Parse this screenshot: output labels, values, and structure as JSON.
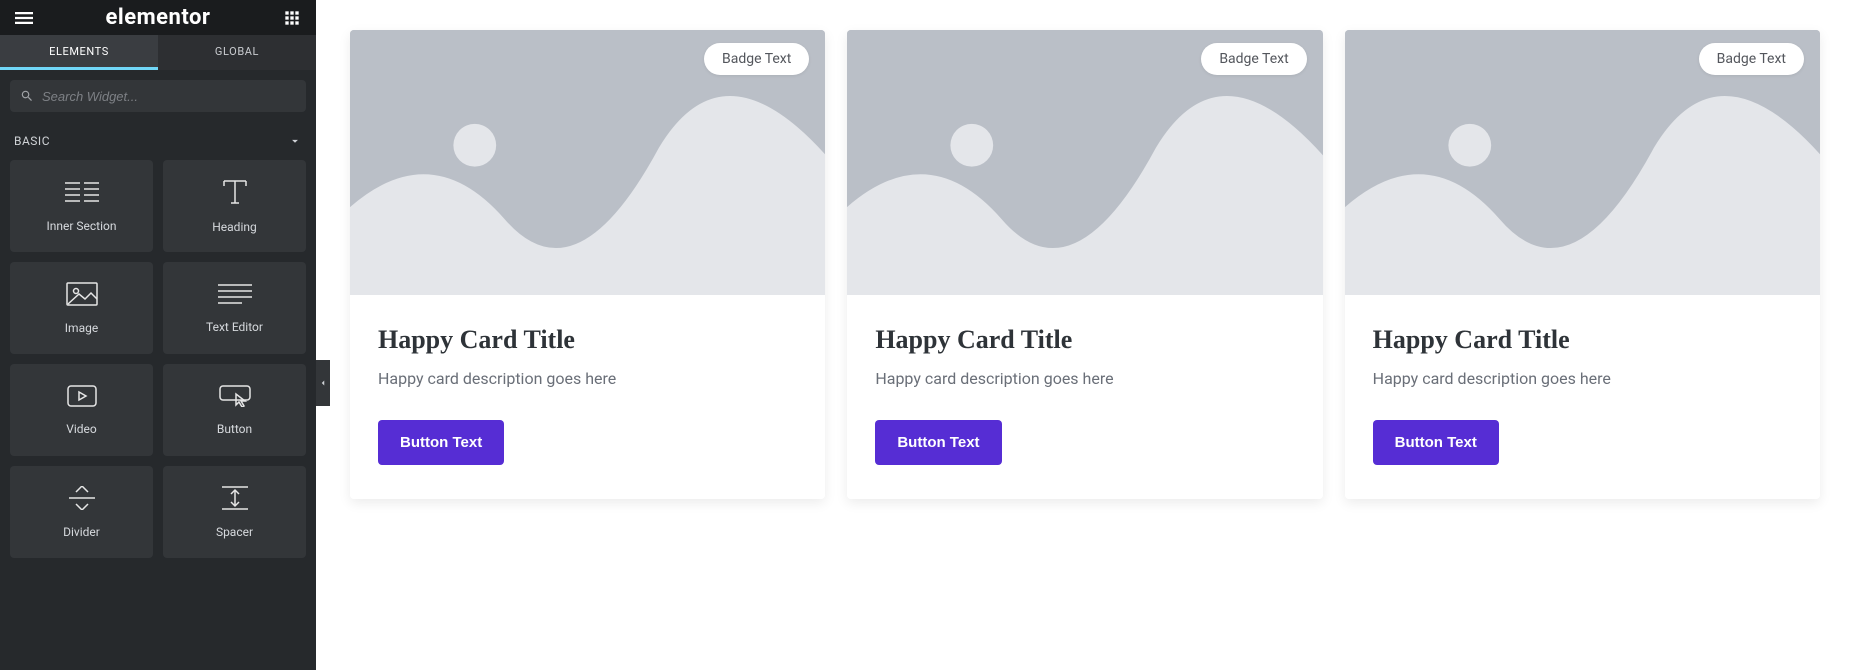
{
  "sidebar": {
    "brand": "elementor",
    "tabs": {
      "elements": "ELEMENTS",
      "global": "GLOBAL"
    },
    "search_placeholder": "Search Widget...",
    "group_label": "BASIC",
    "widgets": [
      {
        "label": "Inner Section",
        "icon": "inner-section"
      },
      {
        "label": "Heading",
        "icon": "heading"
      },
      {
        "label": "Image",
        "icon": "image"
      },
      {
        "label": "Text Editor",
        "icon": "text-editor"
      },
      {
        "label": "Video",
        "icon": "video"
      },
      {
        "label": "Button",
        "icon": "button"
      },
      {
        "label": "Divider",
        "icon": "divider"
      },
      {
        "label": "Spacer",
        "icon": "spacer"
      }
    ]
  },
  "cards": [
    {
      "badge": "Badge Text",
      "title": "Happy Card Title",
      "desc": "Happy card description goes here",
      "button": "Button Text"
    },
    {
      "badge": "Badge Text",
      "title": "Happy Card Title",
      "desc": "Happy card description goes here",
      "button": "Button Text"
    },
    {
      "badge": "Badge Text",
      "title": "Happy Card Title",
      "desc": "Happy card description goes here",
      "button": "Button Text"
    }
  ]
}
